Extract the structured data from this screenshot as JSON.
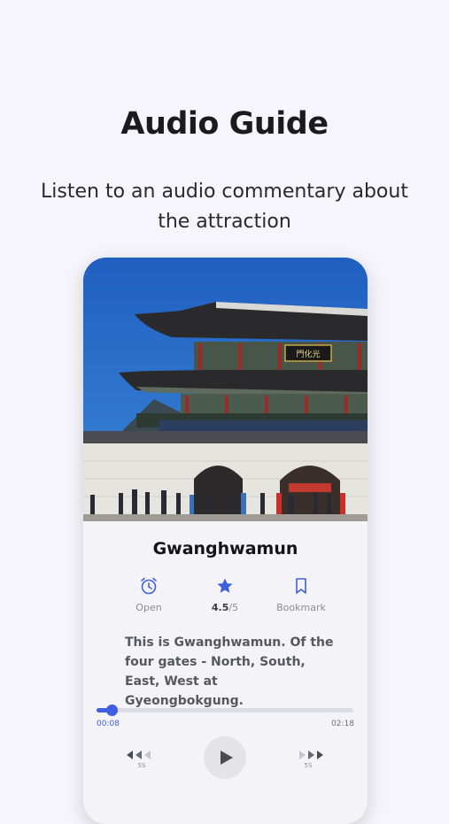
{
  "promo": {
    "headline": "Audio Guide",
    "subline": "Listen to an audio commentary about the attraction"
  },
  "attraction": {
    "name": "Gwanghwamun",
    "description": "This is Gwanghwamun. Of the four gates - North, South, East, West at Gyeongbokgung.",
    "photo_sign": "門化光"
  },
  "actions": {
    "open_label": "Open",
    "rating_value": "4.5",
    "rating_max": "/5",
    "bookmark_label": "Bookmark"
  },
  "player": {
    "current_time": "00:08",
    "total_time": "02:18",
    "progress": 0.058,
    "rewind_seconds": "5S",
    "forward_seconds": "5S"
  },
  "colors": {
    "accent": "#3f5fe0",
    "background": "#f5f5fb"
  },
  "icons": {
    "open": "alarm-clock-icon",
    "rating": "star-icon",
    "bookmark": "bookmark-icon",
    "rewind": "rewind-icon",
    "play": "play-icon",
    "forward": "fast-forward-icon"
  }
}
